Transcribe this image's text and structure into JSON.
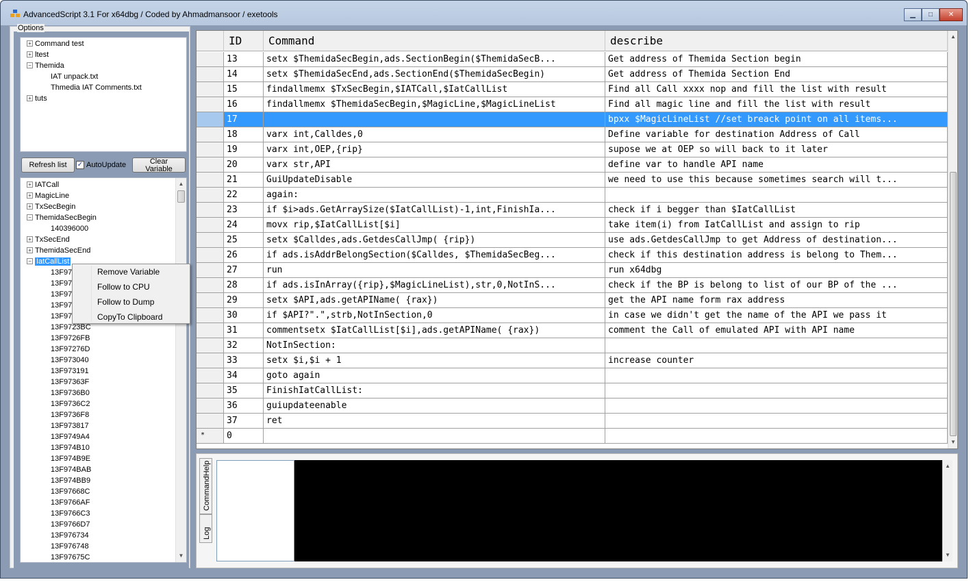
{
  "window": {
    "title": "AdvancedScript 3.1 For x64dbg / Coded by Ahmadmansoor / exetools",
    "minimize_glyph": "▁",
    "maximize_glyph": "□",
    "close_glyph": "✕"
  },
  "options": {
    "legend": "Options",
    "tree": [
      {
        "label": "Command test",
        "expander": "+"
      },
      {
        "label": "ltest",
        "expander": "+"
      },
      {
        "label": "Themida",
        "expander": "−"
      },
      {
        "label": "IAT unpack.txt"
      },
      {
        "label": "Thmedia IAT Comments.txt"
      },
      {
        "label": "tuts",
        "expander": "+"
      }
    ]
  },
  "controls": {
    "refresh_label": "Refresh list",
    "autoupdate_label": "AutoUpdate",
    "autoupdate_check": "✓",
    "clear_label_1": "Clear",
    "clear_label_2": "Variable"
  },
  "variables": {
    "top": [
      {
        "label": "IATCall",
        "expander": "+"
      },
      {
        "label": "MagicLine",
        "expander": "+"
      },
      {
        "label": "TxSecBegin",
        "expander": "+"
      },
      {
        "label": "ThemidaSecBegin",
        "expander": "−"
      },
      {
        "label": "140396000"
      },
      {
        "label": "TxSecEnd",
        "expander": "+"
      },
      {
        "label": "ThemidaSecEnd",
        "expander": "+"
      },
      {
        "label": "IatCallList",
        "expander": "−"
      }
    ],
    "partial": [
      "13F97",
      "13F97",
      "13F97",
      "13F97",
      "13F97",
      "13F9723BC"
    ],
    "items": [
      "13F9726FB",
      "13F97276D",
      "13F973040",
      "13F973191",
      "13F97363F",
      "13F9736B0",
      "13F9736C2",
      "13F9736F8",
      "13F973817",
      "13F9749A4",
      "13F974B10",
      "13F974B9E",
      "13F974BAB",
      "13F974BB9",
      "13F97668C",
      "13F9766AF",
      "13F9766C3",
      "13F9766D7",
      "13F976734",
      "13F976748",
      "13F97675C"
    ]
  },
  "context_menu": {
    "remove": "Remove Variable",
    "cpu": "Follow to CPU",
    "dump": "Follow to Dump",
    "clipboard": "CopyTo Clipboard"
  },
  "grid": {
    "headers": {
      "id": "ID",
      "command": "Command",
      "describe": "describe"
    },
    "rows": [
      {
        "id": "13",
        "cmd": "setx $ThemidaSecBegin,ads.SectionBegin($ThemidaSecB...",
        "desc": "Get address of Themida Section begin"
      },
      {
        "id": "14",
        "cmd": "setx $ThemidaSecEnd,ads.SectionEnd($ThemidaSecBegin)",
        "desc": "Get address of Themida Section End"
      },
      {
        "id": "15",
        "cmd": "findallmemx $TxSecBegin,$IATCall,$IatCallList",
        "desc": "Find all Call xxxx nop and fill the list with result"
      },
      {
        "id": "16",
        "cmd": "findallmemx $ThemidaSecBegin,$MagicLine,$MagicLineList",
        "desc": "Find all magic line and fill the list with result"
      },
      {
        "id": "17",
        "cmd": "",
        "desc": "bpxx $MagicLineList //set breack point on all items..."
      },
      {
        "id": "18",
        "cmd": "varx int,Calldes,0",
        "desc": "Define variable for destination Address of Call"
      },
      {
        "id": "19",
        "cmd": "varx int,OEP,{rip}",
        "desc": "supose we at OEP so will back to it later"
      },
      {
        "id": "20",
        "cmd": "varx str,API",
        "desc": "define var to handle API name"
      },
      {
        "id": "21",
        "cmd": "GuiUpdateDisable",
        "desc": "we need to use this because sometimes search will t..."
      },
      {
        "id": "22",
        "cmd": "again:",
        "desc": ""
      },
      {
        "id": "23",
        "cmd": "if $i>ads.GetArraySize($IatCallList)-1,int,FinishIa...",
        "desc": "check if i begger than $IatCallList"
      },
      {
        "id": "24",
        "cmd": "movx rip,$IatCallList[$i]",
        "desc": "take item(i) from IatCallList and assign to rip"
      },
      {
        "id": "25",
        "cmd": "setx $Calldes,ads.GetdesCallJmp( {rip})",
        "desc": "use ads.GetdesCallJmp to get Address of destination..."
      },
      {
        "id": "26",
        "cmd": "if ads.isAddrBelongSection($Calldes, $ThemidaSecBeg...",
        "desc": "check if this destination address is belong to Them..."
      },
      {
        "id": "27",
        "cmd": "run",
        "desc": "run x64dbg"
      },
      {
        "id": "28",
        "cmd": "if ads.isInArray({rip},$MagicLineList),str,0,NotInS...",
        "desc": "check if the BP is belong to list of our BP of the ..."
      },
      {
        "id": "29",
        "cmd": "setx $API,ads.getAPIName( {rax})",
        "desc": "get the API name form rax address"
      },
      {
        "id": "30",
        "cmd": "if $API?\".\",strb,NotInSection,0",
        "desc": "in case we didn't get the name of the API we pass it"
      },
      {
        "id": "31",
        "cmd": "commentsetx $IatCallList[$i],ads.getAPIName( {rax})",
        "desc": "comment the Call of emulated API with API name"
      },
      {
        "id": "32",
        "cmd": "NotInSection:",
        "desc": ""
      },
      {
        "id": "33",
        "cmd": "setx $i,$i + 1",
        "desc": "increase counter"
      },
      {
        "id": "34",
        "cmd": "goto again",
        "desc": ""
      },
      {
        "id": "35",
        "cmd": "FinishIatCallList:",
        "desc": ""
      },
      {
        "id": "36",
        "cmd": "guiupdateenable",
        "desc": ""
      },
      {
        "id": "37",
        "cmd": "ret",
        "desc": ""
      },
      {
        "id": "0",
        "cmd": "",
        "desc": ""
      }
    ],
    "new_row_marker": "*"
  },
  "bottom_tabs": {
    "command_help": "CommandHelp",
    "log": "Log"
  },
  "colors": {
    "selection": "#3399ff",
    "frame": "#8a9bb3",
    "console": "#000000"
  }
}
